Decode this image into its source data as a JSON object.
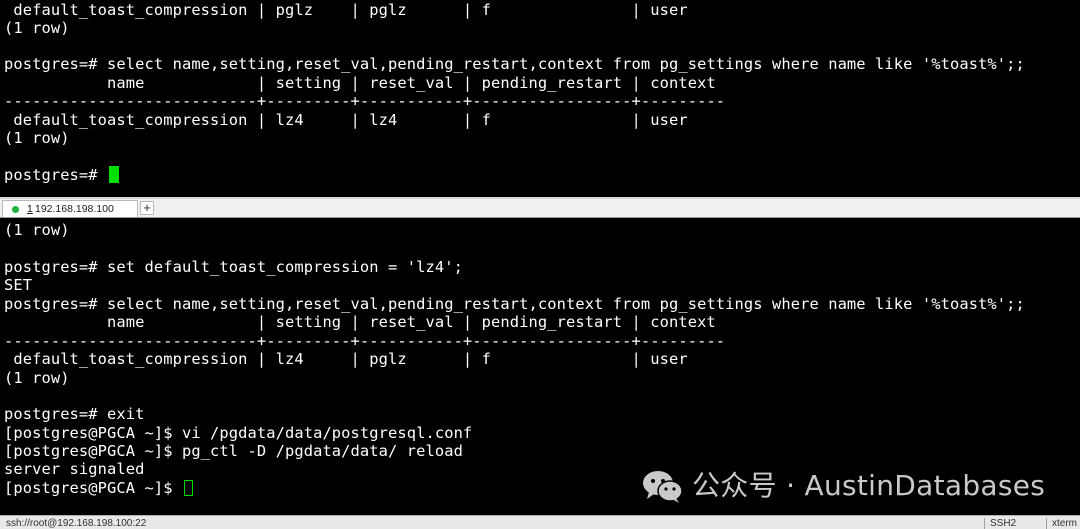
{
  "colors": {
    "terminal_bg": "#000000",
    "terminal_fg": "#ffffff",
    "cursor_active": "#00e000",
    "cursor_inactive": "#00e000",
    "tab_dot": "#1db33a",
    "watermark": "#c9c9c9"
  },
  "top_pane": {
    "lines": [
      " default_toast_compression | pglz    | pglz      | f               | user",
      "(1 row)",
      "",
      "postgres=# select name,setting,reset_val,pending_restart,context from pg_settings where name like '%toast%';;",
      "           name            | setting | reset_val | pending_restart | context",
      "---------------------------+---------+-----------+-----------------+---------",
      " default_toast_compression | lz4     | lz4       | f               | user",
      "(1 row)",
      "",
      "postgres=# "
    ]
  },
  "tab_bar": {
    "session_number": "1",
    "session_host": "192.168.198.100",
    "add_tab_label": "+"
  },
  "bottom_pane": {
    "lines": [
      "(1 row)",
      "",
      "postgres=# set default_toast_compression = 'lz4';",
      "SET",
      "postgres=# select name,setting,reset_val,pending_restart,context from pg_settings where name like '%toast%';;",
      "           name            | setting | reset_val | pending_restart | context",
      "---------------------------+---------+-----------+-----------------+---------",
      " default_toast_compression | lz4     | pglz      | f               | user",
      "(1 row)",
      "",
      "postgres=# exit",
      "[postgres@PGCA ~]$ vi /pgdata/data/postgresql.conf",
      "[postgres@PGCA ~]$ pg_ctl -D /pgdata/data/ reload",
      "server signaled",
      "[postgres@PGCA ~]$ "
    ]
  },
  "watermark": {
    "icon": "wechat-icon",
    "text": "公众号 · AustinDatabases"
  },
  "status_bar": {
    "path": "ssh://root@192.168.198.100:22",
    "protocol": "SSH2",
    "terminal": "xterm"
  }
}
